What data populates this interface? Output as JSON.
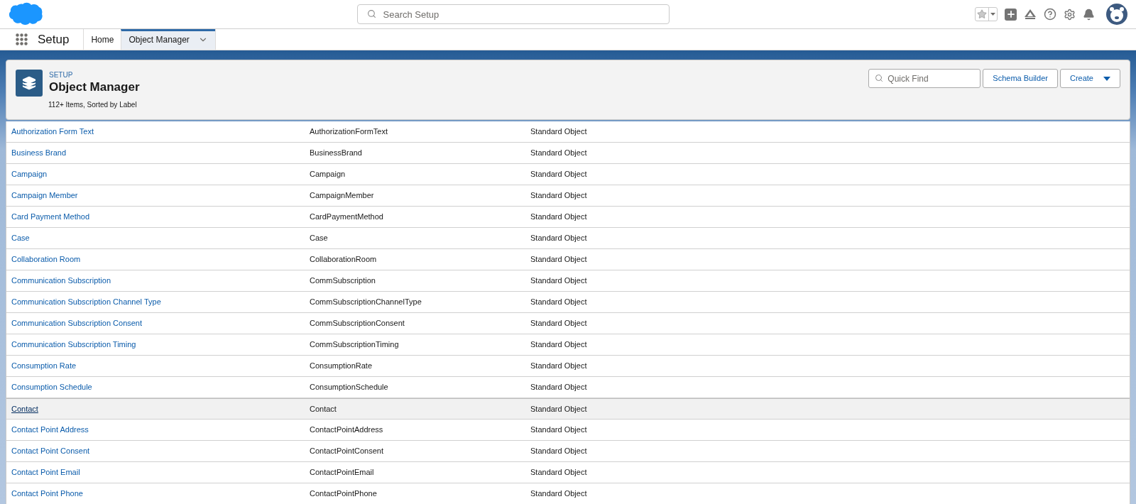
{
  "header": {
    "search": {
      "placeholder": "Search Setup"
    }
  },
  "nav": {
    "app_name": "Setup",
    "tabs": [
      {
        "label": "Home",
        "selected": false,
        "has_menu": false
      },
      {
        "label": "Object Manager",
        "selected": true,
        "has_menu": true
      }
    ]
  },
  "page_header": {
    "breadcrumb": "SETUP",
    "title": "Object Manager",
    "subtitle": "112+ Items, Sorted by Label",
    "quick_find": {
      "placeholder": "Quick Find"
    },
    "buttons": [
      {
        "label": "Schema Builder",
        "has_menu": false
      },
      {
        "label": "Create",
        "has_menu": true
      }
    ]
  },
  "table": {
    "rows": [
      {
        "label": "Authorization Form Text",
        "api_name": "AuthorizationFormText",
        "type": "Standard Object",
        "selected": false
      },
      {
        "label": "Business Brand",
        "api_name": "BusinessBrand",
        "type": "Standard Object",
        "selected": false
      },
      {
        "label": "Campaign",
        "api_name": "Campaign",
        "type": "Standard Object",
        "selected": false
      },
      {
        "label": "Campaign Member",
        "api_name": "CampaignMember",
        "type": "Standard Object",
        "selected": false
      },
      {
        "label": "Card Payment Method",
        "api_name": "CardPaymentMethod",
        "type": "Standard Object",
        "selected": false
      },
      {
        "label": "Case",
        "api_name": "Case",
        "type": "Standard Object",
        "selected": false
      },
      {
        "label": "Collaboration Room",
        "api_name": "CollaborationRoom",
        "type": "Standard Object",
        "selected": false
      },
      {
        "label": "Communication Subscription",
        "api_name": "CommSubscription",
        "type": "Standard Object",
        "selected": false
      },
      {
        "label": "Communication Subscription Channel Type",
        "api_name": "CommSubscriptionChannelType",
        "type": "Standard Object",
        "selected": false
      },
      {
        "label": "Communication Subscription Consent",
        "api_name": "CommSubscriptionConsent",
        "type": "Standard Object",
        "selected": false
      },
      {
        "label": "Communication Subscription Timing",
        "api_name": "CommSubscriptionTiming",
        "type": "Standard Object",
        "selected": false
      },
      {
        "label": "Consumption Rate",
        "api_name": "ConsumptionRate",
        "type": "Standard Object",
        "selected": false
      },
      {
        "label": "Consumption Schedule",
        "api_name": "ConsumptionSchedule",
        "type": "Standard Object",
        "selected": false
      },
      {
        "label": "Contact",
        "api_name": "Contact",
        "type": "Standard Object",
        "selected": true
      },
      {
        "label": "Contact Point Address",
        "api_name": "ContactPointAddress",
        "type": "Standard Object",
        "selected": false
      },
      {
        "label": "Contact Point Consent",
        "api_name": "ContactPointConsent",
        "type": "Standard Object",
        "selected": false
      },
      {
        "label": "Contact Point Email",
        "api_name": "ContactPointEmail",
        "type": "Standard Object",
        "selected": false
      },
      {
        "label": "Contact Point Phone",
        "api_name": "ContactPointPhone",
        "type": "Standard Object",
        "selected": false
      }
    ]
  }
}
